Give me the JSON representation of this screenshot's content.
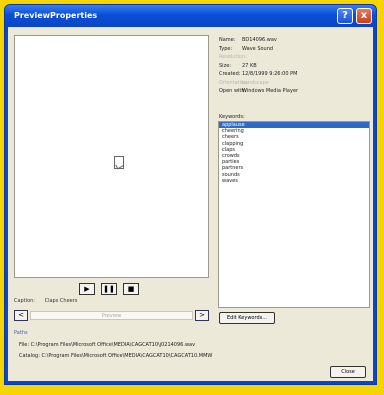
{
  "window": {
    "title": "PreviewProperties",
    "help": "?",
    "close": "x"
  },
  "player": {
    "play": "▶",
    "pause": "❚❚",
    "stop": "■"
  },
  "caption": {
    "label": "Caption:",
    "value": "Claps Cheers"
  },
  "nav": {
    "prev": "<",
    "next": ">",
    "field": "Preview"
  },
  "props": [
    {
      "label": "Name:",
      "value": "BD14096.wav",
      "muted": false
    },
    {
      "label": "Type:",
      "value": "Wave Sound",
      "muted": false
    },
    {
      "label": "Resolution:",
      "value": "",
      "muted": true
    },
    {
      "label": "Size:",
      "value": "27 KB",
      "muted": false
    },
    {
      "label": "Created:",
      "value": "12/8/1999 9:26:00 PM",
      "muted": false
    },
    {
      "label": "Orientation:",
      "value": "Landscape",
      "muted": true
    },
    {
      "label": "Open with:",
      "value": "Windows Media Player",
      "muted": false
    }
  ],
  "keywords": {
    "label": "Keywords:",
    "items": [
      "applause",
      "cheering",
      "cheers",
      "clapping",
      "claps",
      "crowds",
      "parties",
      "partners",
      "sounds",
      "waves"
    ],
    "selected": 0
  },
  "edit_keywords": "Edit Keywords...",
  "paths": {
    "title": "Paths",
    "file": "File:  C:\\Program Files\\Microsoft Office\\MEDIA\\CAGCAT10\\j0214096.wav",
    "catalog": "Catalog:  C:\\Program Files\\Microsoft Office\\MEDIA\\CAGCAT10\\CAGCAT10.MMW"
  },
  "close_button": "Close"
}
